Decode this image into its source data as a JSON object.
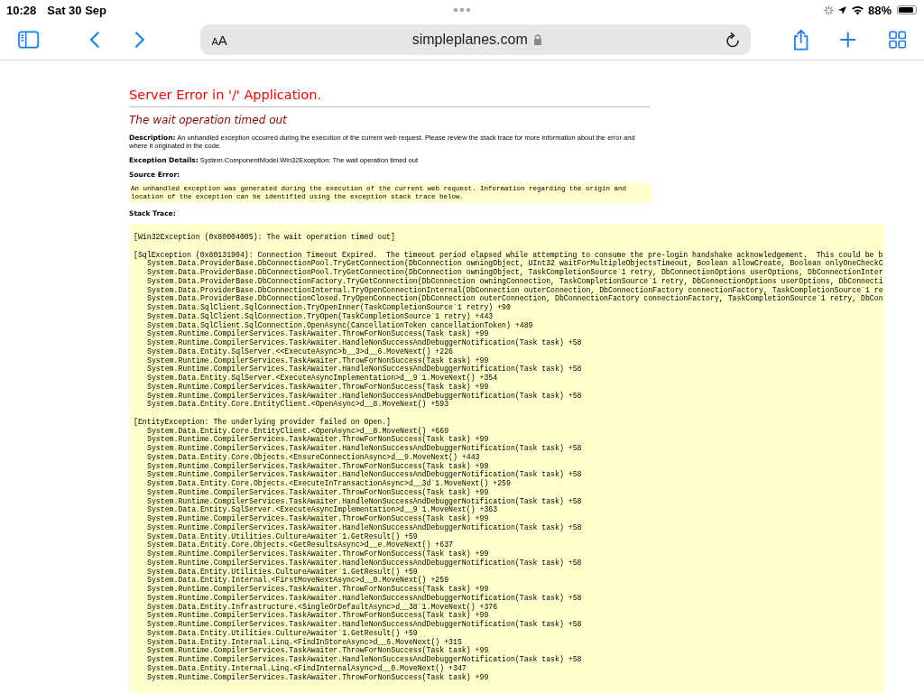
{
  "status_bar": {
    "time": "10:28",
    "date": "Sat 30 Sep",
    "battery": "88%"
  },
  "toolbar": {
    "text_size_button": "AA",
    "url": "simpleplanes.com"
  },
  "page": {
    "title": "Server Error in '/' Application.",
    "subtitle": "The wait operation timed out",
    "details": [
      {
        "label": "Description:",
        "text": "An unhandled exception occurred during the execution of the current web request. Please review the stack trace for more information about the error and where it originated in the code."
      },
      {
        "label": "Exception Details:",
        "text": "System.ComponentModel.Win32Exception: The wait operation timed out"
      }
    ],
    "source_error": {
      "label": "Source Error:",
      "text": "An unhandled exception was generated during the execution of the current web request. Information regarding the origin and location of the exception can be identified using the exception stack trace below."
    },
    "stack_trace": {
      "label": "Stack Trace:",
      "exceptions": [
        {
          "header": "[Win32Exception (0x80004005): The wait operation timed out]"
        },
        {
          "header": "[SqlException (0x80131904): Connection Timeout Expired.  The timeout period elapsed while attempting to consume the pre-login handshake acknowledgement.  This could be b",
          "frames": [
            "System.Data.ProviderBase.DbConnectionPool.TryGetConnection(DbConnection owningObject, UInt32 waitForMultipleObjectsTimeout, Boolean allowCreate, Boolean onlyOneCheckC",
            "System.Data.ProviderBase.DbConnectionPool.TryGetConnection(DbConnection owningObject, TaskCompletionSource`1 retry, DbConnectionOptions userOptions, DbConnectionInter",
            "System.Data.ProviderBase.DbConnectionFactory.TryGetConnection(DbConnection owningConnection, TaskCompletionSource`1 retry, DbConnectionOptions userOptions, DbConnecti",
            "System.Data.ProviderBase.DbConnectionInternal.TryOpenConnectionInternal(DbConnection outerConnection, DbConnectionFactory connectionFactory, TaskCompletionSource`1 re",
            "System.Data.ProviderBase.DbConnectionClosed.TryOpenConnection(DbConnection outerConnection, DbConnectionFactory connectionFactory, TaskCompletionSource`1 retry, DbCon",
            "System.Data.SqlClient.SqlConnection.TryOpenInner(TaskCompletionSource`1 retry) +90",
            "System.Data.SqlClient.SqlConnection.TryOpen(TaskCompletionSource`1 retry) +443",
            "System.Data.SqlClient.SqlConnection.OpenAsync(CancellationToken cancellationToken) +489",
            "System.Runtime.CompilerServices.TaskAwaiter.ThrowForNonSuccess(Task task) +99",
            "System.Runtime.CompilerServices.TaskAwaiter.HandleNonSuccessAndDebuggerNotification(Task task) +58",
            "System.Data.Entity.SqlServer.<<ExecuteAsync>b__3>d__6.MoveNext() +226",
            "System.Runtime.CompilerServices.TaskAwaiter.ThrowForNonSuccess(Task task) +99",
            "System.Runtime.CompilerServices.TaskAwaiter.HandleNonSuccessAndDebuggerNotification(Task task) +58",
            "System.Data.Entity.SqlServer.<ExecuteAsyncImplementation>d__9`1.MoveNext() +354",
            "System.Runtime.CompilerServices.TaskAwaiter.ThrowForNonSuccess(Task task) +99",
            "System.Runtime.CompilerServices.TaskAwaiter.HandleNonSuccessAndDebuggerNotification(Task task) +58",
            "System.Data.Entity.Core.EntityClient.<OpenAsync>d__8.MoveNext() +593"
          ]
        },
        {
          "header": "[EntityException: The underlying provider failed on Open.]",
          "frames": [
            "System.Data.Entity.Core.EntityClient.<OpenAsync>d__8.MoveNext() +669",
            "System.Runtime.CompilerServices.TaskAwaiter.ThrowForNonSuccess(Task task) +99",
            "System.Runtime.CompilerServices.TaskAwaiter.HandleNonSuccessAndDebuggerNotification(Task task) +58",
            "System.Data.Entity.Core.Objects.<EnsureConnectionAsync>d__9.MoveNext() +443",
            "System.Runtime.CompilerServices.TaskAwaiter.ThrowForNonSuccess(Task task) +99",
            "System.Runtime.CompilerServices.TaskAwaiter.HandleNonSuccessAndDebuggerNotification(Task task) +58",
            "System.Data.Entity.Core.Objects.<ExecuteInTransactionAsync>d__3d`1.MoveNext() +259",
            "System.Runtime.CompilerServices.TaskAwaiter.ThrowForNonSuccess(Task task) +99",
            "System.Runtime.CompilerServices.TaskAwaiter.HandleNonSuccessAndDebuggerNotification(Task task) +58",
            "System.Data.Entity.SqlServer.<ExecuteAsyncImplementation>d__9`1.MoveNext() +363",
            "System.Runtime.CompilerServices.TaskAwaiter.ThrowForNonSuccess(Task task) +99",
            "System.Runtime.CompilerServices.TaskAwaiter.HandleNonSuccessAndDebuggerNotification(Task task) +58",
            "System.Data.Entity.Utilities.CultureAwaiter`1.GetResult() +59",
            "System.Data.Entity.Core.Objects.<GetResultsAsync>d__e.MoveNext() +637",
            "System.Runtime.CompilerServices.TaskAwaiter.ThrowForNonSuccess(Task task) +99",
            "System.Runtime.CompilerServices.TaskAwaiter.HandleNonSuccessAndDebuggerNotification(Task task) +58",
            "System.Data.Entity.Utilities.CultureAwaiter`1.GetResult() +59",
            "System.Data.Entity.Internal.<FirstMoveNextAsync>d__0.MoveNext() +259",
            "System.Runtime.CompilerServices.TaskAwaiter.ThrowForNonSuccess(Task task) +99",
            "System.Runtime.CompilerServices.TaskAwaiter.HandleNonSuccessAndDebuggerNotification(Task task) +58",
            "System.Data.Entity.Infrastructure.<SingleOrDefaultAsync>d__38`1.MoveNext() +376",
            "System.Runtime.CompilerServices.TaskAwaiter.ThrowForNonSuccess(Task task) +99",
            "System.Runtime.CompilerServices.TaskAwaiter.HandleNonSuccessAndDebuggerNotification(Task task) +58",
            "System.Data.Entity.Utilities.CultureAwaiter`1.GetResult() +59",
            "System.Data.Entity.Internal.Linq.<FindInStoreAsync>d__6.MoveNext() +315",
            "System.Runtime.CompilerServices.TaskAwaiter.ThrowForNonSuccess(Task task) +99",
            "System.Runtime.CompilerServices.TaskAwaiter.HandleNonSuccessAndDebuggerNotification(Task task) +58",
            "System.Data.Entity.Internal.Linq.<FindInternalAsync>d__0.MoveNext() +347",
            "System.Runtime.CompilerServices.TaskAwaiter.ThrowForNonSuccess(Task task) +99"
          ]
        }
      ]
    }
  }
}
